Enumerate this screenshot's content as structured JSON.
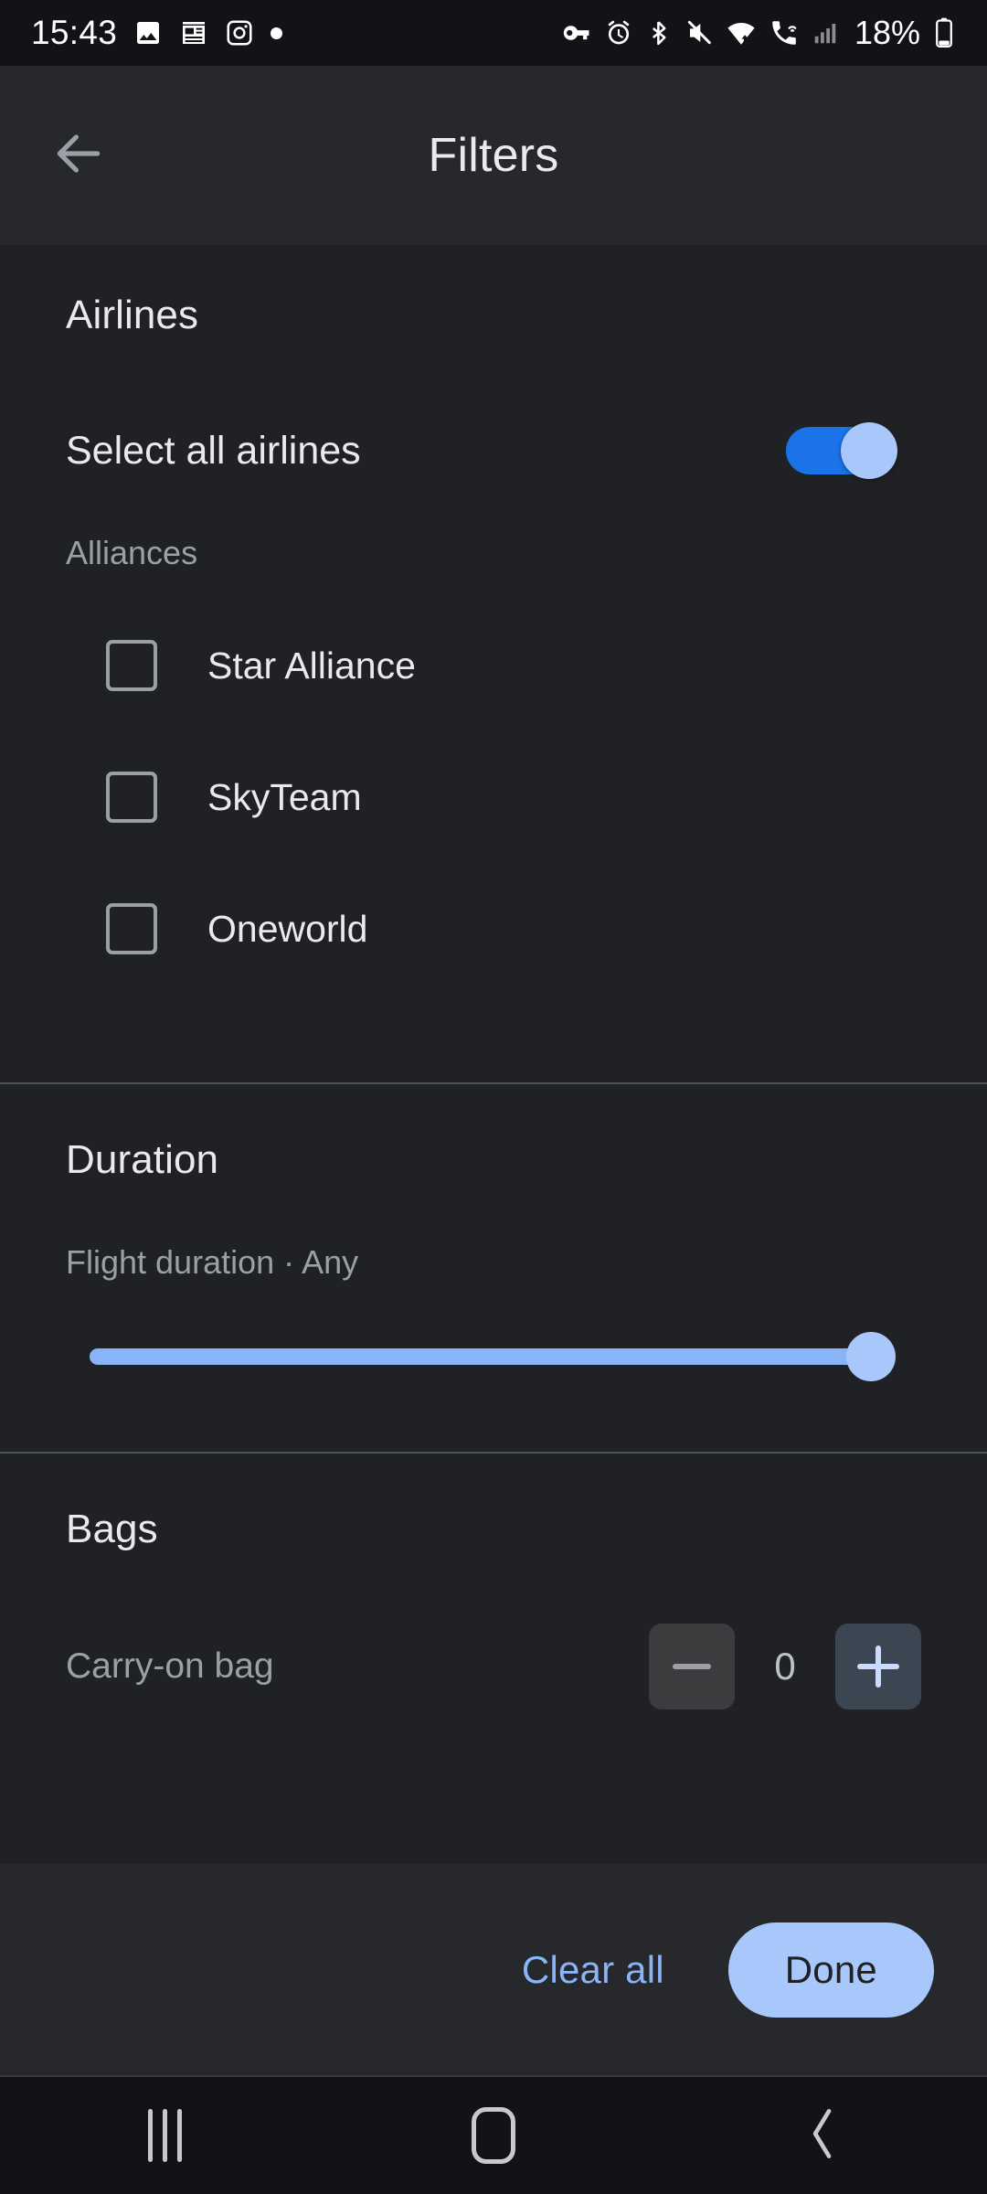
{
  "status_bar": {
    "time": "15:43",
    "battery_percent": "18%",
    "left_icons": [
      "photos-icon",
      "news-icon",
      "instagram-icon",
      "dot-icon"
    ],
    "right_icons": [
      "vpn-key-icon",
      "alarm-icon",
      "bluetooth-icon",
      "mute-icon",
      "wifi-icon",
      "wifi-calling-icon",
      "signal-icon",
      "battery-icon"
    ]
  },
  "app_bar": {
    "title": "Filters",
    "back_icon": "arrow-back-icon"
  },
  "airlines": {
    "title": "Airlines",
    "select_all_label": "Select all airlines",
    "select_all_on": true,
    "alliances_label": "Alliances",
    "alliances": [
      {
        "label": "Star Alliance",
        "checked": false
      },
      {
        "label": "SkyTeam",
        "checked": false
      },
      {
        "label": "Oneworld",
        "checked": false
      }
    ]
  },
  "duration": {
    "title": "Duration",
    "subtitle": "Flight duration · Any",
    "slider_value": 100,
    "slider_min": 0,
    "slider_max": 100
  },
  "bags": {
    "title": "Bags",
    "carry_on_label": "Carry-on bag",
    "carry_on_count": "0",
    "minus_label": "−",
    "plus_label": "+"
  },
  "action_bar": {
    "clear_label": "Clear all",
    "done_label": "Done"
  },
  "nav_bar": {
    "recents": "recents-icon",
    "home": "home-icon",
    "back": "back-icon"
  },
  "colors": {
    "background": "#202124",
    "surface": "#26282c",
    "accent_blue": "#8ab4f8",
    "toggle_on": "#1a73e8",
    "thumb": "#a8c7fa",
    "text_primary": "#e8eaed",
    "text_secondary": "#9aa0a6"
  }
}
